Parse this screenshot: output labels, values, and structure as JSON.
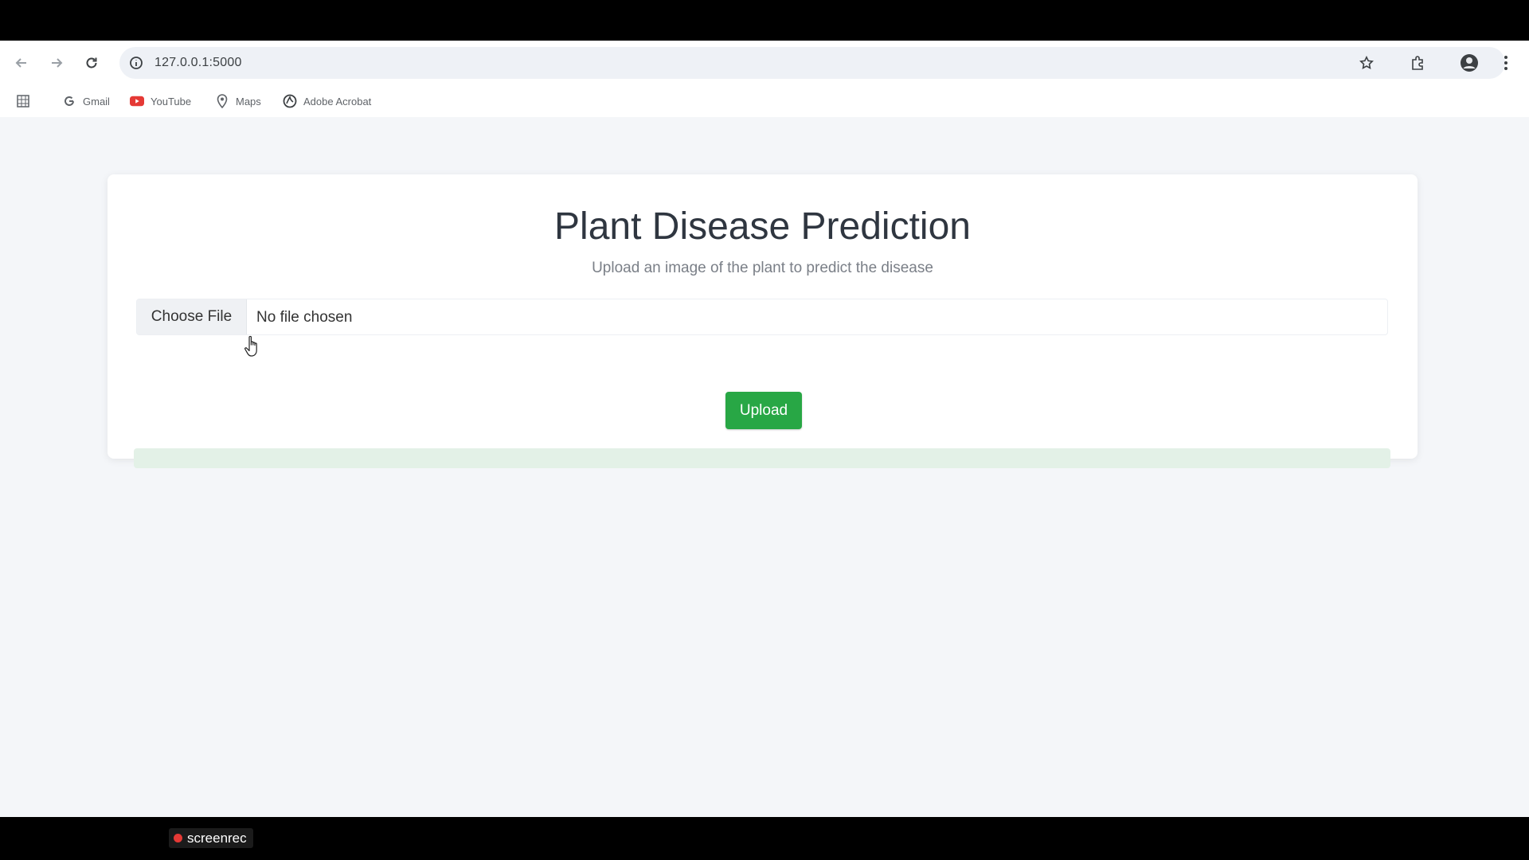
{
  "browser": {
    "url": "127.0.0.1:5000",
    "nav": {
      "back_icon": "arrow-left-icon",
      "forward_icon": "arrow-right-icon",
      "reload_icon": "reload-icon"
    },
    "bookmarks": [
      {
        "label": "Gmail",
        "icon": "google-icon"
      },
      {
        "label": "YouTube",
        "icon": "youtube-icon"
      },
      {
        "label": "Maps",
        "icon": "maps-pin-icon"
      },
      {
        "label": "Adobe Acrobat",
        "icon": "acrobat-icon"
      }
    ]
  },
  "page": {
    "title": "Plant Disease Prediction",
    "subtitle": "Upload an image of the plant to predict the disease",
    "file_input": {
      "button_label": "Choose File",
      "status": "No file chosen"
    },
    "upload_label": "Upload"
  },
  "recorder": {
    "label": "screenrec"
  },
  "colors": {
    "upload_button": "#28a745",
    "page_background": "#f4f6f9",
    "result_bar": "#e3f1e7"
  }
}
